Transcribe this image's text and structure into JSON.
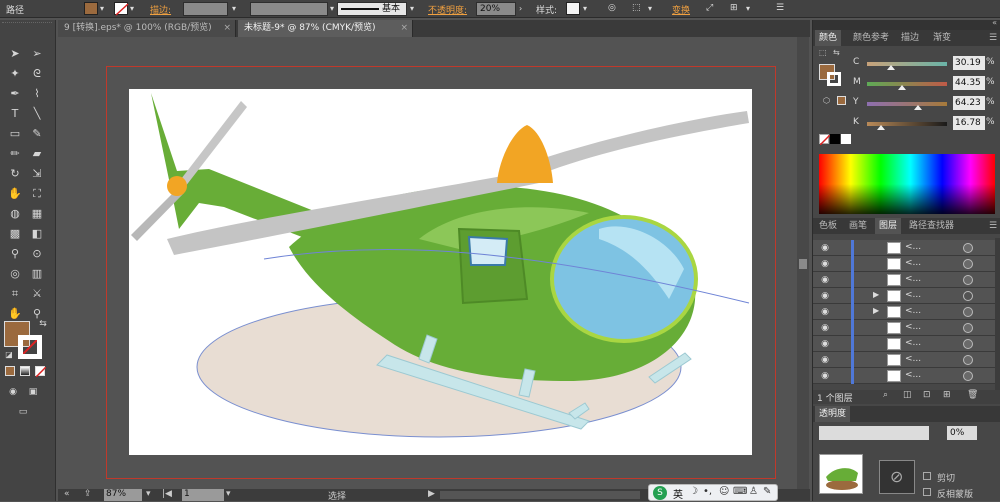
{
  "control_bar": {
    "object_type": "路径",
    "stroke_label": "描边:",
    "brush_label": "基本",
    "opacity_label": "不透明度:",
    "opacity_value": "20%",
    "style_label": "样式:",
    "recolor_label": "变换",
    "fill_color": "#9b6a3e"
  },
  "tabs": [
    {
      "label": "9 [转换].eps* @ 100% (RGB/预览)",
      "close": "×"
    },
    {
      "label": "未标题-9* @ 87% (CMYK/预览)",
      "close": "×"
    }
  ],
  "tools": {
    "type_tool": "T",
    "fill_color": "#9b6a3e"
  },
  "status_bar": {
    "zoom": "87%",
    "page": "1",
    "mode": "选择"
  },
  "color_panel": {
    "tabs": [
      "颜色",
      "颜色参考",
      "描边",
      "渐变"
    ],
    "channels": [
      {
        "name": "C",
        "value": "30.19",
        "unit": "%",
        "level": 0.3,
        "gradient": [
          "#c8a27a",
          "#6ab4a8"
        ]
      },
      {
        "name": "M",
        "value": "44.35",
        "unit": "%",
        "level": 0.44,
        "gradient": [
          "#5eab56",
          "#c05a48"
        ]
      },
      {
        "name": "Y",
        "value": "64.23",
        "unit": "%",
        "level": 0.64,
        "gradient": [
          "#8e6fb0",
          "#a67a3a"
        ]
      },
      {
        "name": "K",
        "value": "16.78",
        "unit": "%",
        "level": 0.17,
        "gradient": [
          "#b98a58",
          "#1a1a1a"
        ]
      }
    ],
    "fill_color": "#9b6a3e"
  },
  "layers_panel": {
    "tabs": [
      "色板",
      "画笔",
      "图层",
      "路径查找器"
    ],
    "rows": [
      {
        "name": "<...",
        "arrow": "",
        "target": "filled"
      },
      {
        "name": "<...",
        "arrow": "",
        "target": "filled"
      },
      {
        "name": "<...",
        "arrow": "",
        "target": "filled"
      },
      {
        "name": "<...",
        "arrow": "▶",
        "target": "hollow"
      },
      {
        "name": "<...",
        "arrow": "▶",
        "target": "filled"
      },
      {
        "name": "<...",
        "arrow": "",
        "target": "filled"
      },
      {
        "name": "<...",
        "arrow": "",
        "target": "filled"
      },
      {
        "name": "<...",
        "arrow": "",
        "target": "filled"
      },
      {
        "name": "<...",
        "arrow": "",
        "target": "filled"
      }
    ],
    "count_label": "1 个图层"
  },
  "transparency_panel": {
    "label": "透明度",
    "value": "0%",
    "clip_label": "剪切",
    "invert_label": "反相蒙版"
  },
  "ime": {
    "lang": "英"
  }
}
